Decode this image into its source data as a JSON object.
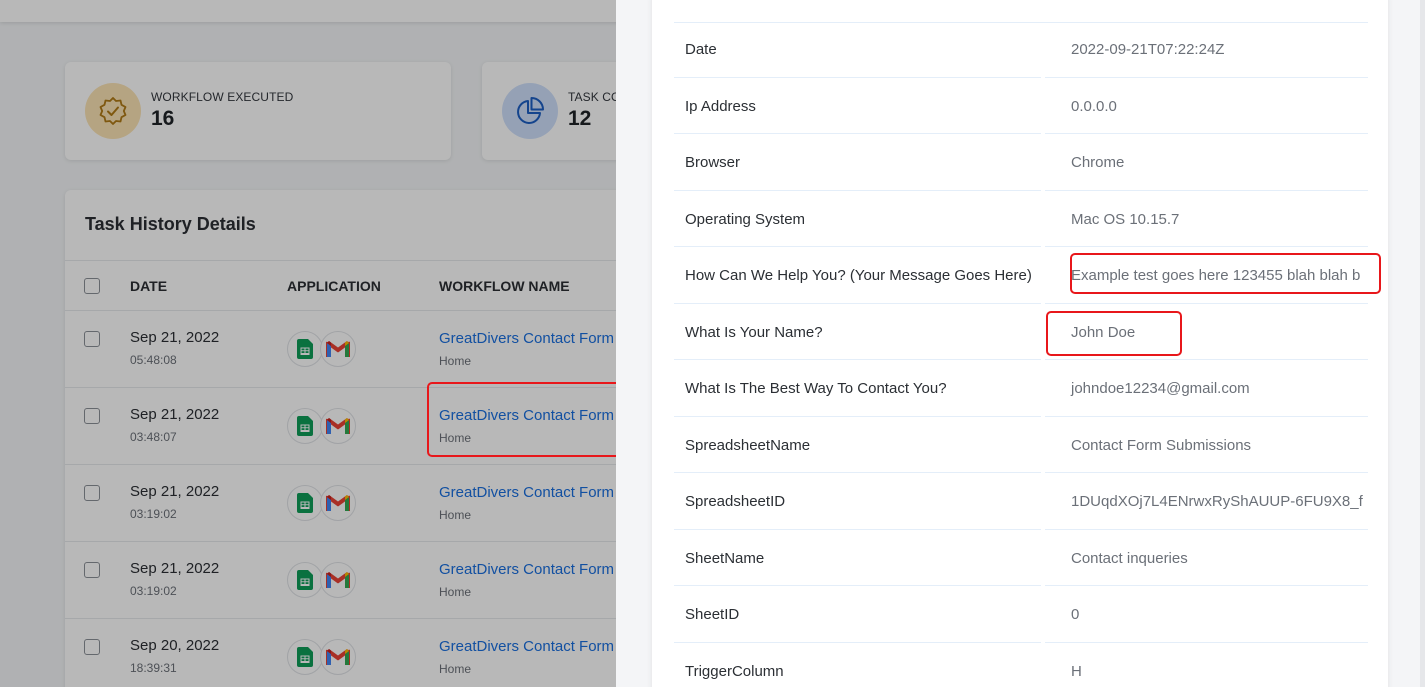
{
  "stats": [
    {
      "label": "WORKFLOW EXECUTED",
      "value": "16",
      "icon": "badge-check-icon"
    },
    {
      "label": "TASK CO",
      "value": "12",
      "icon": "pie-chart-icon"
    }
  ],
  "history": {
    "title": "Task History Details",
    "columns": [
      "DATE",
      "APPLICATION",
      "WORKFLOW NAME"
    ],
    "rows": [
      {
        "date": "Sep 21, 2022",
        "time": "05:48:08",
        "workflow": "GreatDivers Contact Form",
        "sub": "Home"
      },
      {
        "date": "Sep 21, 2022",
        "time": "03:48:07",
        "workflow": "GreatDivers Contact Form",
        "sub": "Home"
      },
      {
        "date": "Sep 21, 2022",
        "time": "03:19:02",
        "workflow": "GreatDivers Contact Form",
        "sub": "Home"
      },
      {
        "date": "Sep 21, 2022",
        "time": "03:19:02",
        "workflow": "GreatDivers Contact Form",
        "sub": "Home"
      },
      {
        "date": "Sep 20, 2022",
        "time": "18:39:31",
        "workflow": "GreatDivers Contact Form",
        "sub": "Home"
      }
    ]
  },
  "details": [
    {
      "key": "Date",
      "value": "2022-09-21T07:22:24Z"
    },
    {
      "key": "Ip Address",
      "value": "0.0.0.0"
    },
    {
      "key": "Browser",
      "value": "Chrome"
    },
    {
      "key": "Operating System",
      "value": "Mac OS 10.15.7"
    },
    {
      "key": "How Can We Help You? (Your Message Goes Here)",
      "value": "Example test goes here 123455 blah blah b"
    },
    {
      "key": "What Is Your Name?",
      "value": "John Doe"
    },
    {
      "key": "What Is The Best Way To Contact You?",
      "value": "johndoe12234@gmail.com"
    },
    {
      "key": "SpreadsheetName",
      "value": "Contact Form Submissions"
    },
    {
      "key": "SpreadsheetID",
      "value": "1DUqdXOj7L4ENrwxRyShAUUP-6FU9X8_f"
    },
    {
      "key": "SheetName",
      "value": "Contact inqueries"
    },
    {
      "key": "SheetID",
      "value": "0"
    },
    {
      "key": "TriggerColumn",
      "value": "H"
    }
  ],
  "colors": {
    "link": "#1a6fe0",
    "highlight": "#e8171b"
  }
}
